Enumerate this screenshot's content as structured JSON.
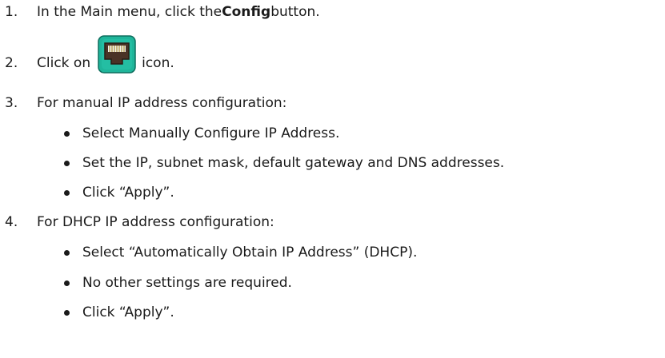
{
  "steps": [
    {
      "num": "1.",
      "pre": "In the Main menu, click the ",
      "bold": "Config",
      "post": " button."
    },
    {
      "num": "2.",
      "pre": "Click on",
      "post": "icon.",
      "icon": "ethernet-port-icon",
      "icon_bg": "#1fb59a"
    },
    {
      "num": "3.",
      "text": "For manual IP address configuration:",
      "bullets": [
        "Select Manually Configure IP Address.",
        "Set the IP, subnet mask, default gateway and DNS addresses.",
        "Click “Apply”."
      ]
    },
    {
      "num": "4.",
      "text": "For DHCP IP address configuration:",
      "bullets": [
        "Select “Automatically Obtain IP Address” (DHCP).",
        "No other settings are required.",
        "Click “Apply”."
      ]
    }
  ]
}
